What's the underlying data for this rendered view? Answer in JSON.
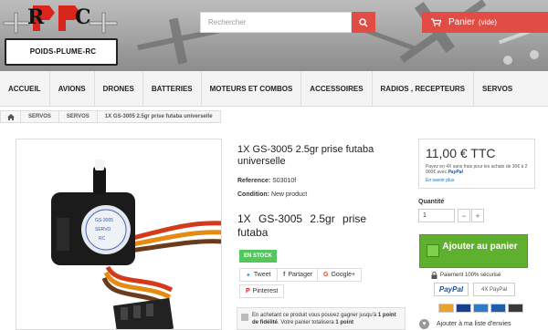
{
  "header": {
    "logo_text": "POIDS-PLUME-RC",
    "logo_letters": [
      "R",
      "C"
    ],
    "search_placeholder": "Rechercher",
    "cart_label": "Panier",
    "cart_status": "(vide)"
  },
  "nav": {
    "items": [
      "ACCUEIL",
      "AVIONS",
      "DRONES",
      "BATTERIES",
      "MOTEURS ET COMBOS",
      "ACCESSOIRES",
      "RADIOS , RECEPTEURS",
      "SERVOS"
    ]
  },
  "breadcrumb": {
    "items": [
      "SERVOS",
      "SERVOS",
      "1X GS-3005 2.5gr prise futaba universelle"
    ]
  },
  "product": {
    "title": "1X GS-3005 2.5gr prise futaba universelle",
    "reference_label": "Reference:",
    "reference_value": "S03010f",
    "condition_label": "Condition:",
    "condition_value": "New product",
    "short_desc": "1X GS-3005 2.5gr prise futaba",
    "stock_label": "EN STOCK",
    "share_tweet": "Tweet",
    "share_facebook": "Partager",
    "share_google": "Google+",
    "share_pinterest": "Pinterest",
    "fidelity_part1": "En achetant ce produit vous pouvez gagner jusqu'à ",
    "fidelity_bold1": "1 point de fidélité",
    "fidelity_part2": ". Votre panier totalisera ",
    "fidelity_bold2": "1 point"
  },
  "buy": {
    "price": "11,00 € TTC",
    "pay_note": "Payez en 4X sans frais pour les achats de 30€ à 2 000€ avec",
    "pay_brand": "PayPal",
    "more_link": "En savoir plus",
    "qty_label": "Quantité",
    "qty_value": "1",
    "add_to_cart": "Ajouter au panier",
    "secure_label": "Paiement 100% sécurisé",
    "paypal_button": "PayPal",
    "paypal_4x": "4X PayPal",
    "wishlist": "Ajouter à ma liste d'envies"
  },
  "colors": {
    "accent_red": "#e14c45",
    "stock_green": "#55c65e",
    "cart_green": "#5fb02e",
    "paypal_blue": "#1a4fa0"
  },
  "icons": [
    "home-icon",
    "search-icon",
    "cart-icon",
    "twitter-icon",
    "facebook-icon",
    "google-plus-icon",
    "pinterest-icon",
    "lock-icon",
    "heart-icon"
  ]
}
